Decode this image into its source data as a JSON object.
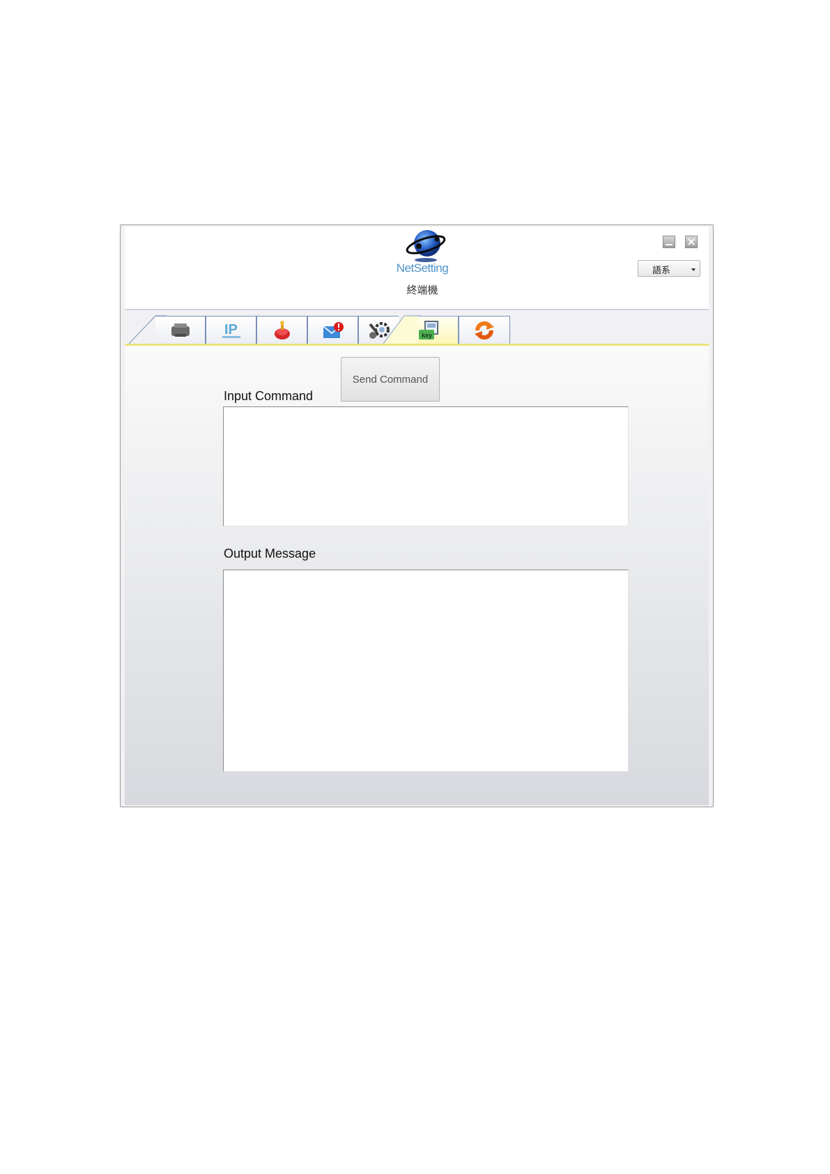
{
  "header": {
    "app_title": "NetSetting",
    "page_subtitle": "終端機",
    "language_select_value": "語系"
  },
  "window_controls": [
    "minimize-icon",
    "close-icon"
  ],
  "tabs": [
    {
      "icon": "printer-icon",
      "active": false
    },
    {
      "icon": "ip-network-icon",
      "active": false
    },
    {
      "icon": "alarm-icon",
      "active": false
    },
    {
      "icon": "mail-alert-icon",
      "active": false
    },
    {
      "icon": "tools-settings-icon",
      "active": false
    },
    {
      "icon": "terminal-key-icon",
      "active": true
    },
    {
      "icon": "refresh-icon",
      "active": false
    }
  ],
  "terminal": {
    "input_label": "Input Command",
    "send_button_label": "Send Command",
    "input_value": "",
    "output_label": "Output Message",
    "output_value": ""
  },
  "colors": {
    "active_tab": "#fbf6b8",
    "tab_border": "#7a8fb8",
    "panel_top_border": "#eae57a",
    "app_title": "#4f93c9"
  }
}
